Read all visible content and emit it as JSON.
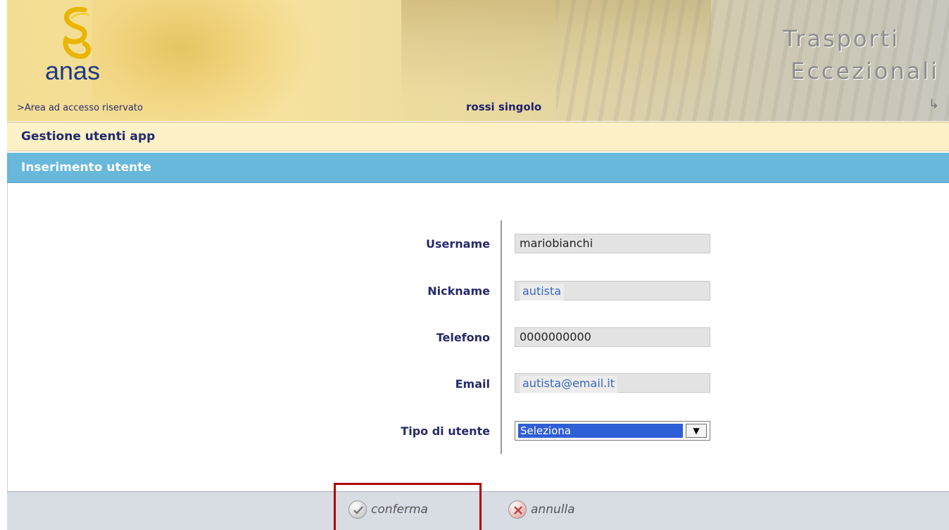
{
  "header": {
    "logo_text": "anas",
    "title_line1": "Trasporti",
    "title_line2": "Eccezionali",
    "area_link": ">Area ad accesso riservato",
    "user_name": "rossi singolo"
  },
  "section": {
    "title": "Gestione utenti app",
    "subtitle": "Inserimento utente"
  },
  "form": {
    "username": {
      "label": "Username",
      "value": "mariobianchi"
    },
    "nickname": {
      "label": "Nickname",
      "value": "autista"
    },
    "telefono": {
      "label": "Telefono",
      "value": "0000000000"
    },
    "email": {
      "label": "Email",
      "value": "autista@email.it"
    },
    "tipo_utente": {
      "label": "Tipo di utente",
      "selected": "Seleziona"
    }
  },
  "footer": {
    "confirm_label": "conferma",
    "cancel_label": "annulla"
  },
  "colors": {
    "section_bar": "#fdf1c7",
    "subsection_bar": "#67b8da",
    "highlight": "#b00000",
    "select_highlight": "#2f5fd6"
  }
}
